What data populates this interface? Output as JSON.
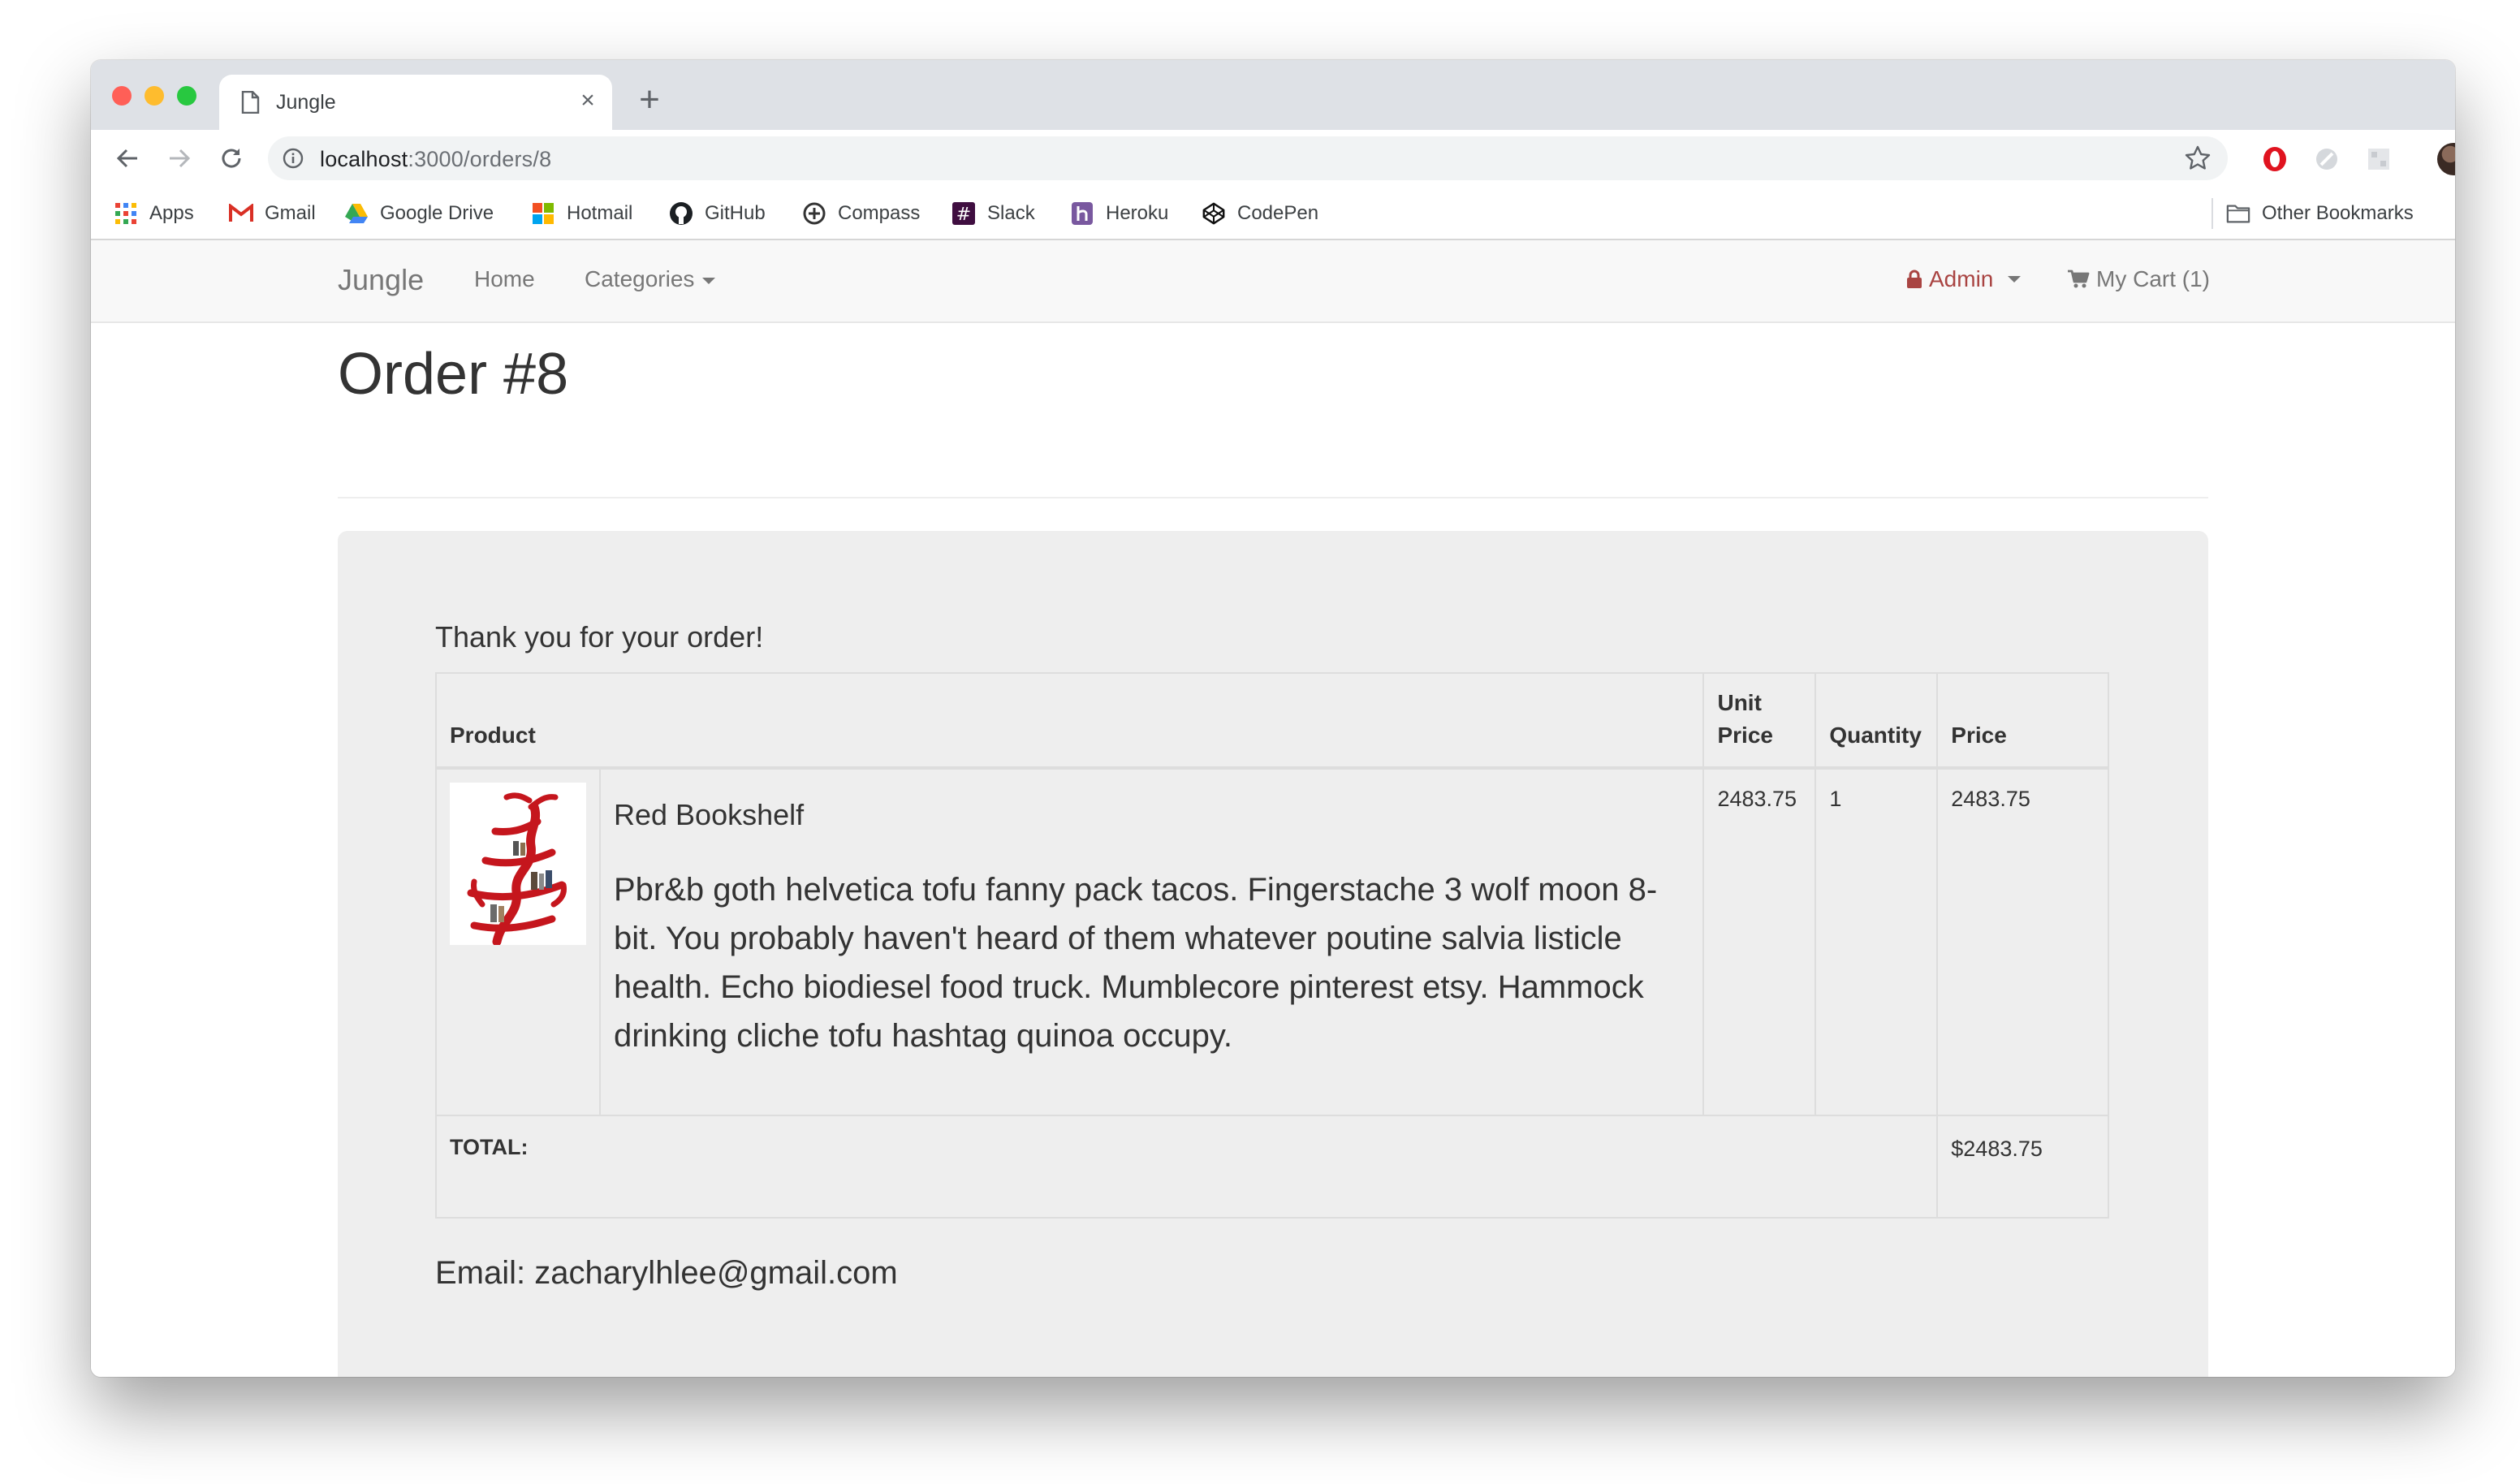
{
  "browser": {
    "tab_title": "Jungle",
    "tab_close": "×",
    "new_tab": "+",
    "url_host": "localhost",
    "url_path": ":3000/orders/8",
    "bookmarks": [
      {
        "label": "Apps",
        "icon": "apps-grid-icon"
      },
      {
        "label": "Gmail",
        "icon": "gmail-icon"
      },
      {
        "label": "Google Drive",
        "icon": "google-drive-icon"
      },
      {
        "label": "Hotmail",
        "icon": "hotmail-icon"
      },
      {
        "label": "GitHub",
        "icon": "github-icon"
      },
      {
        "label": "Compass",
        "icon": "compass-icon"
      },
      {
        "label": "Slack",
        "icon": "slack-icon"
      },
      {
        "label": "Heroku",
        "icon": "heroku-icon"
      },
      {
        "label": "CodePen",
        "icon": "codepen-icon"
      }
    ],
    "other_bookmarks": "Other Bookmarks"
  },
  "site_nav": {
    "brand": "Jungle",
    "home": "Home",
    "categories": "Categories",
    "admin": "Admin",
    "cart": "My Cart (1)"
  },
  "order": {
    "title": "Order #8",
    "thanks": "Thank you for your order!",
    "headers": {
      "product": "Product",
      "unit_price": "Unit Price",
      "quantity": "Quantity",
      "price": "Price"
    },
    "items": [
      {
        "name": "Red Bookshelf",
        "description": "Pbr&b goth helvetica tofu fanny pack tacos. Fingerstache 3 wolf moon 8-bit. You probably haven't heard of them whatever poutine salvia listicle health. Echo biodiesel food truck. Mumblecore pinterest etsy. Hammock drinking cliche tofu hashtag quinoa occupy.",
        "unit_price": "2483.75",
        "quantity": "1",
        "price": "2483.75"
      }
    ],
    "total_label": "TOTAL:",
    "total_value": "$2483.75",
    "email": "Email: zacharylhlee@gmail.com"
  },
  "colors": {
    "admin_red": "#a94442",
    "panel_bg": "#eeeeee",
    "navbar_bg": "#f8f8f8"
  }
}
